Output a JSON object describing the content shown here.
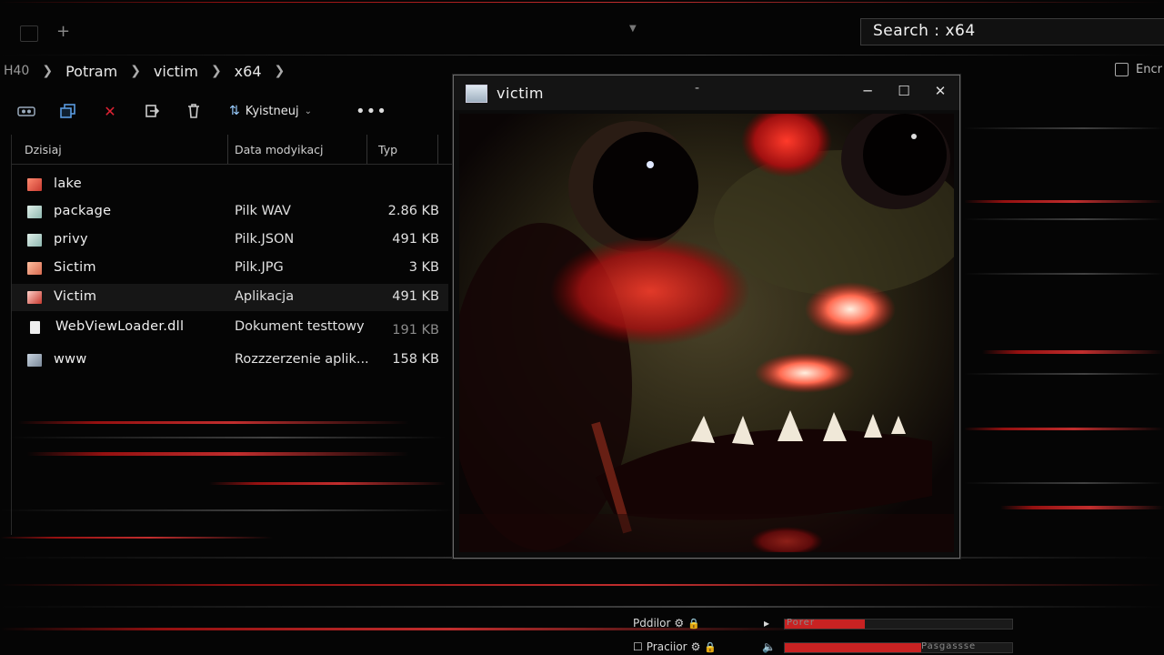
{
  "search": {
    "label": "Search : x64"
  },
  "breadcrumb": {
    "root": "H40",
    "items": [
      "Potram",
      "victim",
      "x64"
    ]
  },
  "encr": {
    "label": "Encr"
  },
  "toolbar": {
    "sort_label": "Kyistneuj",
    "more_label": "•••"
  },
  "columns": {
    "name": "Dzisiaj",
    "date": "Data modyikacj",
    "type": "Typ"
  },
  "files": [
    {
      "name": "lake",
      "type": "",
      "size": "",
      "icon": "image-file-icon",
      "color": "#e05a4e"
    },
    {
      "name": "package",
      "type": "Pilk WAV",
      "size": "2.86 KB",
      "icon": "audio-file-icon",
      "color": "#bcd8d0"
    },
    {
      "name": "privy",
      "type": "Pilk.JSON",
      "size": "491 KB",
      "icon": "json-file-icon",
      "color": "#bcd8d0"
    },
    {
      "name": "Sictim",
      "type": "Pilk.JPG",
      "size": "3 KB",
      "icon": "image-file-icon",
      "color": "#e58a70"
    },
    {
      "name": "Victim",
      "type": "Aplikacja",
      "size": "491 KB",
      "icon": "application-icon",
      "color": "#e05a4e"
    },
    {
      "name": "WebViewLoader.dll",
      "type": "Dokument testtowy",
      "size": "191 KB",
      "icon": "dll-file-icon",
      "color": "#dddddd"
    },
    {
      "name": "www",
      "type": "Rozzzerzenie aplik...",
      "size": "158 KB",
      "icon": "extension-file-icon",
      "color": "#aab8c8"
    }
  ],
  "viewer": {
    "title": "victim",
    "dash": "-"
  },
  "status": {
    "item1": "Pddilor",
    "item2": "Praciior"
  },
  "meters": [
    {
      "label": "Porer",
      "level": 0.35
    },
    {
      "label": "Pasgassse",
      "level": 0.6
    }
  ],
  "colors": {
    "accent_red": "#c82222",
    "background": "#050505"
  }
}
